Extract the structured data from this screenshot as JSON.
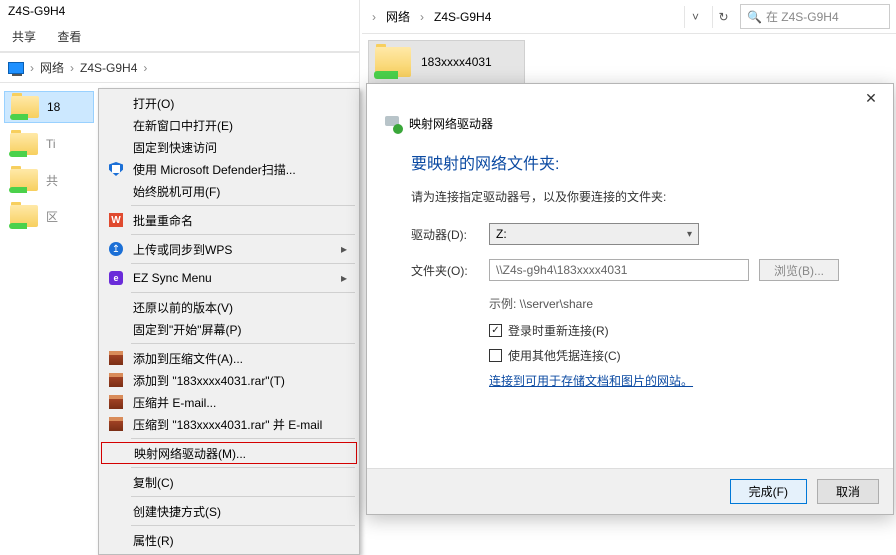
{
  "left": {
    "title": "Z4S-G9H4",
    "toolbar": {
      "share": "共享",
      "view": "查看"
    },
    "crumbs": {
      "c1": "网络",
      "c2": "Z4S-G9H4"
    },
    "items": {
      "i0": "183xxxx4031",
      "i0short": "18",
      "i1": "Ti",
      "i2": "共",
      "i3": "区"
    }
  },
  "ctx": {
    "open": "打开(O)",
    "newwin": "在新窗口中打开(E)",
    "pin": "固定到快速访问",
    "defender": "使用 Microsoft Defender扫描...",
    "offline": "始终脱机可用(F)",
    "rename": "批量重命名",
    "wps": "上传或同步到WPS",
    "ez": "EZ Sync Menu",
    "restore": "还原以前的版本(V)",
    "pinstart": "固定到\"开始\"屏幕(P)",
    "rar1": "添加到压缩文件(A)...",
    "rar2": "添加到 \"183xxxx4031.rar\"(T)",
    "rar3": "压缩并 E-mail...",
    "rar4": "压缩到 \"183xxxx4031.rar\" 并 E-mail",
    "map": "映射网络驱动器(M)...",
    "copy": "复制(C)",
    "shortcut": "创建快捷方式(S)",
    "props": "属性(R)"
  },
  "right": {
    "crumbs": {
      "c1": "网络",
      "c2": "Z4S-G9H4"
    },
    "searchph": "在 Z4S-G9H4",
    "folder": "183xxxx4031"
  },
  "dialog": {
    "headtitle": "映射网络驱动器",
    "h1": "要映射的网络文件夹:",
    "desc": "请为连接指定驱动器号，以及你要连接的文件夹:",
    "drivelbl": "驱动器(D):",
    "driveval": "Z:",
    "folderlbl": "文件夹(O):",
    "folderval": "\\\\Z4s-g9h4\\183xxxx4031",
    "browse": "浏览(B)...",
    "example": "示例: \\\\server\\share",
    "chk1": "登录时重新连接(R)",
    "chk2": "使用其他凭据连接(C)",
    "link": "连接到可用于存储文档和图片的网站",
    "finish": "完成(F)",
    "cancel": "取消"
  }
}
